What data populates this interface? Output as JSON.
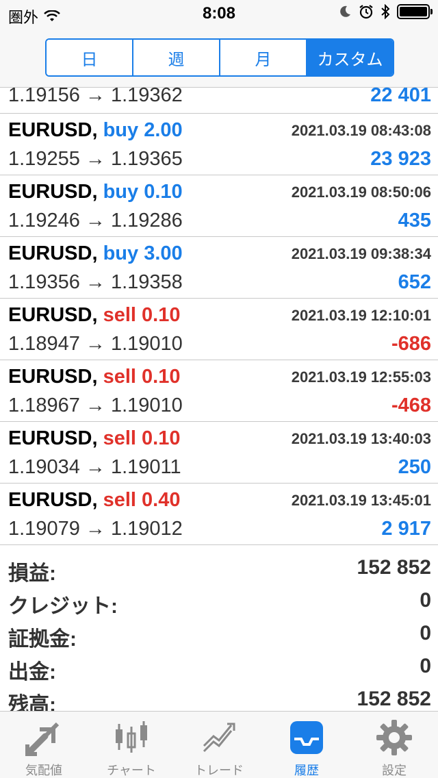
{
  "status_bar": {
    "carrier": "圏外",
    "time": "8:08"
  },
  "period_tabs": [
    {
      "label": "日",
      "active": false
    },
    {
      "label": "週",
      "active": false
    },
    {
      "label": "月",
      "active": false
    },
    {
      "label": "カスタム",
      "active": true
    }
  ],
  "partial_row": {
    "prices": "1.19156 → 1.19362",
    "profit": "22 401"
  },
  "trades": [
    {
      "symbol": "EURUSD,",
      "direction": "buy",
      "volume": "buy 2.00",
      "datetime": "2021.03.19 08:43:08",
      "prices": "1.19255 → 1.19365",
      "profit": "23 923"
    },
    {
      "symbol": "EURUSD,",
      "direction": "buy",
      "volume": "buy 0.10",
      "datetime": "2021.03.19 08:50:06",
      "prices": "1.19246 → 1.19286",
      "profit": "435"
    },
    {
      "symbol": "EURUSD,",
      "direction": "buy",
      "volume": "buy 3.00",
      "datetime": "2021.03.19 09:38:34",
      "prices": "1.19356 → 1.19358",
      "profit": "652"
    },
    {
      "symbol": "EURUSD,",
      "direction": "sell",
      "volume": "sell 0.10",
      "datetime": "2021.03.19 12:10:01",
      "prices": "1.18947 → 1.19010",
      "profit": "-686"
    },
    {
      "symbol": "EURUSD,",
      "direction": "sell",
      "volume": "sell 0.10",
      "datetime": "2021.03.19 12:55:03",
      "prices": "1.18967 → 1.19010",
      "profit": "-468"
    },
    {
      "symbol": "EURUSD,",
      "direction": "sell",
      "volume": "sell 0.10",
      "datetime": "2021.03.19 13:40:03",
      "prices": "1.19034 → 1.19011",
      "profit": "250"
    },
    {
      "symbol": "EURUSD,",
      "direction": "sell",
      "volume": "sell 0.40",
      "datetime": "2021.03.19 13:45:01",
      "prices": "1.19079 → 1.19012",
      "profit": "2 917"
    }
  ],
  "summary": [
    {
      "label": "損益:",
      "value": "152 852"
    },
    {
      "label": "クレジット:",
      "value": "0"
    },
    {
      "label": "証拠金:",
      "value": "0"
    },
    {
      "label": "出金:",
      "value": "0"
    },
    {
      "label": "残高:",
      "value": "152 852"
    }
  ],
  "tabbar": [
    {
      "label": "気配値",
      "icon": "quotes-icon",
      "active": false
    },
    {
      "label": "チャート",
      "icon": "chart-icon",
      "active": false
    },
    {
      "label": "トレード",
      "icon": "trade-icon",
      "active": false
    },
    {
      "label": "履歴",
      "icon": "history-icon",
      "active": true
    },
    {
      "label": "設定",
      "icon": "settings-icon",
      "active": false
    }
  ],
  "colors": {
    "accent": "#1a7ee8",
    "sell": "#e0312a",
    "inactive_tab": "#8a8a8a"
  }
}
